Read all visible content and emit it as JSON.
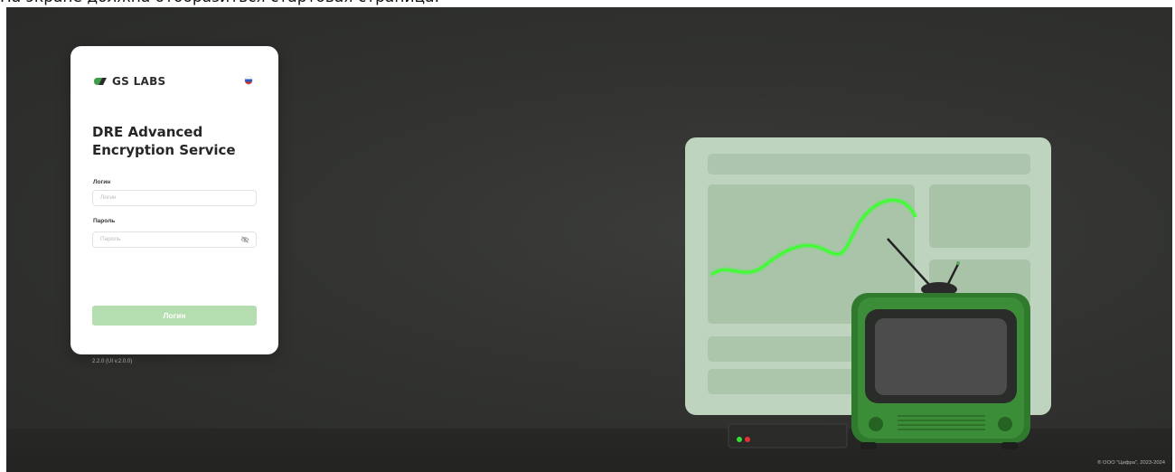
{
  "caption": "На экране должна отобразиться стартовая страница:",
  "app": {
    "brand": "GS LABS",
    "title_line1": "DRE Advanced",
    "title_line2": "Encryption Service",
    "language_flag": "ru-flag"
  },
  "form": {
    "login_label": "Логин",
    "login_placeholder": "Логин",
    "password_label": "Пароль",
    "password_placeholder": "Пароль",
    "submit_label": "Логин",
    "version": "2.2.0 (UI v.2.0.0)"
  },
  "footer": {
    "copyright": "® ООО \"Цифра\", 2023-2024"
  },
  "colors": {
    "accent": "#b5deb0",
    "background": "#2f302e",
    "brand_green": "#3c9e45",
    "neon_green": "#2cff2c"
  }
}
